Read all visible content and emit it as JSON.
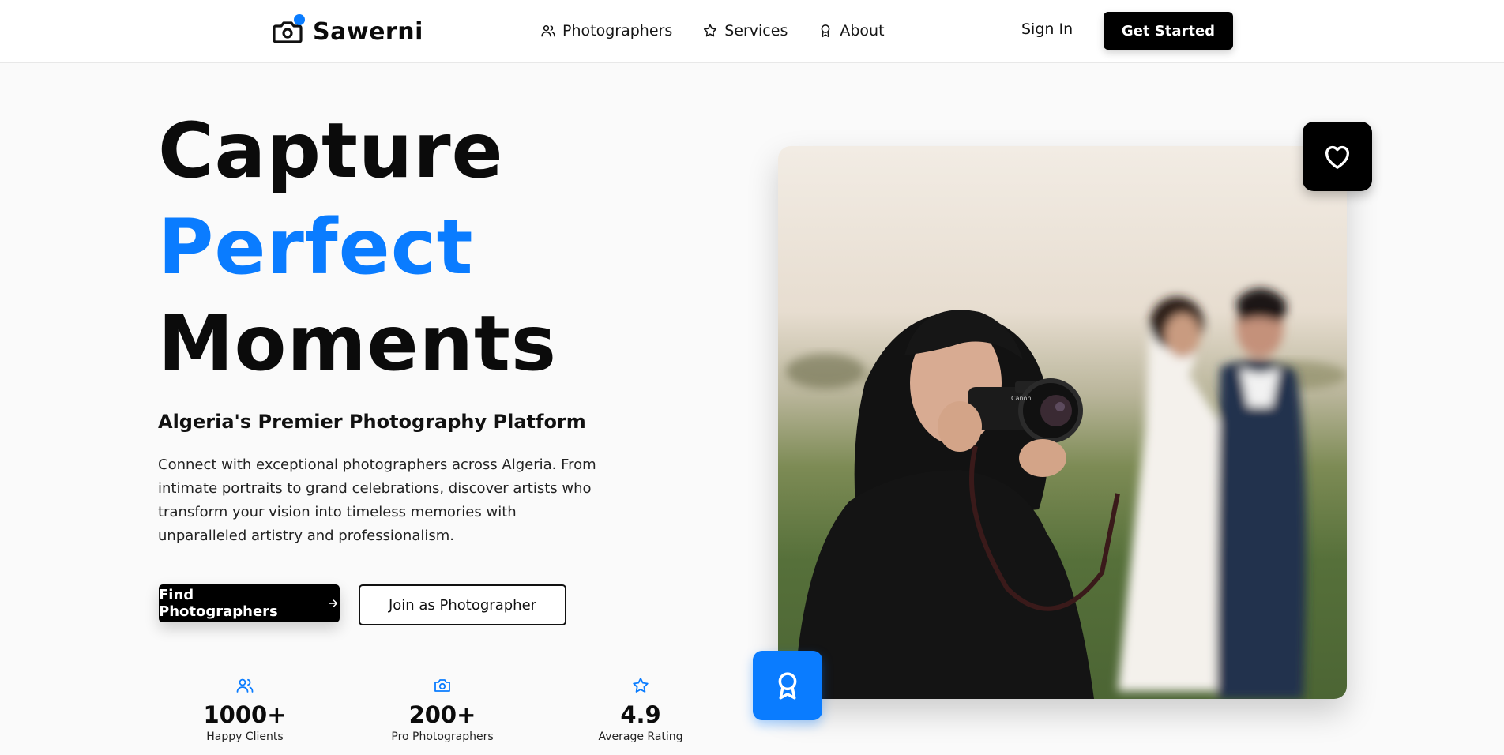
{
  "brand": {
    "name": "Sawerni",
    "accent": "#0a7cff"
  },
  "nav": {
    "links": [
      {
        "label": "Photographers",
        "icon": "users-icon"
      },
      {
        "label": "Services",
        "icon": "star-icon"
      },
      {
        "label": "About",
        "icon": "award-icon"
      }
    ],
    "sign_in": "Sign In",
    "get_started": "Get Started"
  },
  "hero": {
    "title_line1": "Capture",
    "title_line2": "Perfect",
    "title_line3": "Moments",
    "subtitle": "Algeria's Premier Photography Platform",
    "description": "Connect with exceptional photographers across Algeria. From intimate portraits to grand celebrations, discover artists who transform your vision into timeless memories with unparalleled artistry and professionalism.",
    "primary_button": "Find Photographers",
    "secondary_button": "Join as Photographer"
  },
  "stats": [
    {
      "value": "1000+",
      "label": "Happy Clients",
      "icon": "users-icon"
    },
    {
      "value": "200+",
      "label": "Pro Photographers",
      "icon": "camera-icon"
    },
    {
      "value": "4.9",
      "label": "Average Rating",
      "icon": "star-icon"
    }
  ],
  "image": {
    "camera_brand": "Canon",
    "badges": {
      "top": "heart-icon",
      "bottom": "award-icon"
    }
  }
}
